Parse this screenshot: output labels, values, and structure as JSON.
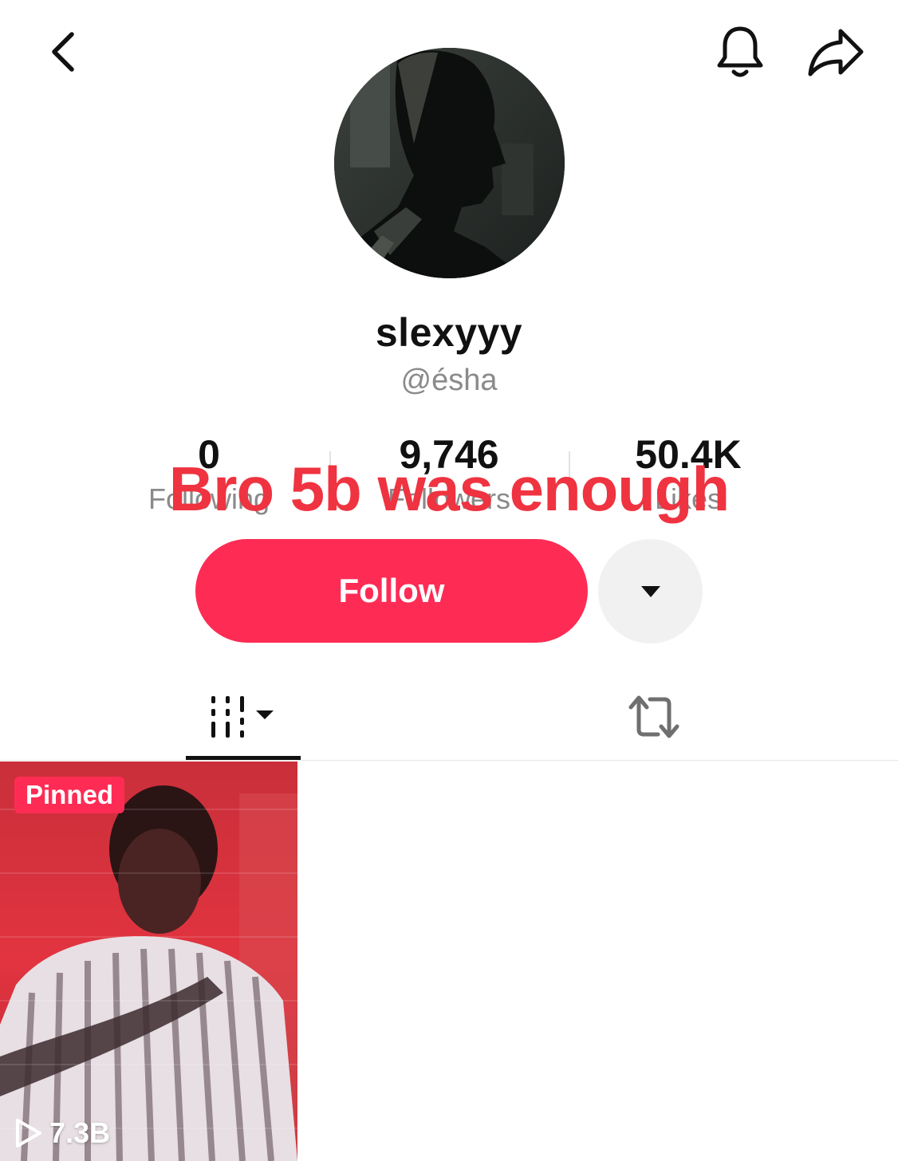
{
  "header": {
    "back_icon": "chevron-left-icon",
    "notification_icon": "bell-icon",
    "share_icon": "share-arrow-icon"
  },
  "profile": {
    "display_name": "slexyyy",
    "username": "@ésha",
    "stats": [
      {
        "value": "0",
        "label": "Following"
      },
      {
        "value": "9,746",
        "label": "Followers"
      },
      {
        "value": "50.4K",
        "label": "Likes"
      }
    ]
  },
  "overlay": {
    "caption": "Bro 5b was enough",
    "color": "#ef3340"
  },
  "actions": {
    "follow_label": "Follow",
    "follow_color": "#fe2c55",
    "more_icon": "caret-down-icon"
  },
  "tabs": [
    {
      "name": "videos",
      "icon": "grid-columns-icon",
      "selected": true
    },
    {
      "name": "reposts",
      "icon": "repost-icon",
      "selected": false
    }
  ],
  "videos": [
    {
      "badge": "Pinned",
      "views": "7.3B",
      "play_icon": "play-outline-icon"
    }
  ]
}
